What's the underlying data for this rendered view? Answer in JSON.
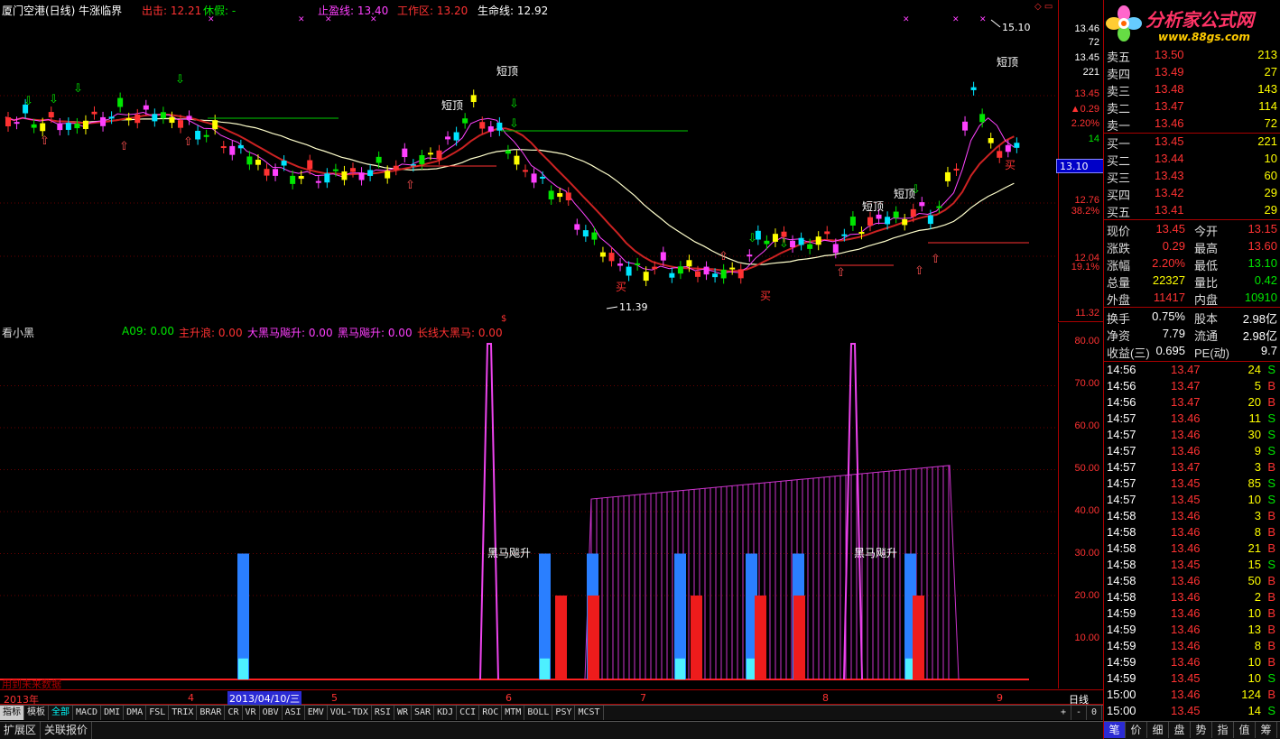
{
  "header": {
    "title": "厦门空港(日线) 牛涨临界",
    "items": [
      {
        "label": "出击:",
        "value": "12.21",
        "color": "#ff3232"
      },
      {
        "label": "休假:",
        "value": "-",
        "color": "#00e600"
      },
      {
        "label": "止盈线:",
        "value": "13.40",
        "color": "#ff40ff"
      },
      {
        "label": "工作区:",
        "value": "13.20",
        "color": "#ff3232"
      },
      {
        "label": "生命线:",
        "value": "12.92",
        "color": "#ffffff"
      }
    ]
  },
  "main_chart": {
    "high_label": "15.10",
    "low_label": "11.39",
    "annotations": [
      "短顶",
      "短顶",
      "短顶",
      "短顶",
      "短顶",
      "买",
      "买",
      "买"
    ],
    "price_marker": "13.10"
  },
  "price_axis": [
    {
      "v": "13.46",
      "c": "#fff"
    },
    {
      "v": "72",
      "c": "#fff"
    },
    {
      "v": "13.45",
      "c": "#fff"
    },
    {
      "v": "221",
      "c": "#fff"
    },
    {
      "v": "13.45",
      "c": "#ff3232"
    },
    {
      "v": "▲0.29",
      "c": "#ff3232"
    },
    {
      "v": "2.20%",
      "c": "#ff3232"
    },
    {
      "v": "14",
      "c": "#00e600"
    },
    {
      "v": "12.76",
      "c": "#ff3232"
    },
    {
      "v": "38.2%",
      "c": "#ff3232"
    },
    {
      "v": "12.04",
      "c": "#ff3232"
    },
    {
      "v": "19.1%",
      "c": "#ff3232"
    },
    {
      "v": "11.32",
      "c": "#ff3232"
    }
  ],
  "indicator": {
    "name": "看小黑",
    "items": [
      {
        "label": "A09:",
        "value": "0.00",
        "color": "#00e600"
      },
      {
        "label": "主升浪:",
        "value": "0.00",
        "color": "#ff3232"
      },
      {
        "label": "大黑马飚升:",
        "value": "0.00",
        "color": "#ff40ff"
      },
      {
        "label": "黑马飚升:",
        "value": "0.00",
        "color": "#ff40ff"
      },
      {
        "label": "长线大黑马:",
        "value": "0.00",
        "color": "#ff3232"
      }
    ],
    "labels": [
      "黑马飚升",
      "黑马飚升"
    ],
    "footnote": "用到未来数据",
    "axis": [
      "80.00",
      "70.00",
      "60.00",
      "50.00",
      "40.00",
      "30.00",
      "20.00",
      "10.00"
    ]
  },
  "timeline": {
    "year": "2013年",
    "months": [
      "4",
      "5",
      "6",
      "7",
      "8",
      "9"
    ],
    "cursor_date": "2013/04/10/三",
    "period": "日线"
  },
  "tabs": [
    "指标",
    "模板",
    "全部",
    "MACD",
    "DMI",
    "DMA",
    "FSL",
    "TRIX",
    "BRAR",
    "CR",
    "VR",
    "OBV",
    "ASI",
    "EMV",
    "VOL-TDX",
    "RSI",
    "WR",
    "SAR",
    "KDJ",
    "CCI",
    "ROC",
    "MTM",
    "BOLL",
    "PSY",
    "MCST"
  ],
  "tab_controls": [
    "+",
    "-",
    "0"
  ],
  "bottom_tabs": [
    "扩展区",
    "关联报价"
  ],
  "right_panel": {
    "logo": "分析家公式网",
    "logo_url": "www.88gs.com",
    "asks": [
      {
        "label": "卖五",
        "price": "13.50",
        "vol": "213"
      },
      {
        "label": "卖四",
        "price": "13.49",
        "vol": "27"
      },
      {
        "label": "卖三",
        "price": "13.48",
        "vol": "143"
      },
      {
        "label": "卖二",
        "price": "13.47",
        "vol": "114"
      },
      {
        "label": "卖一",
        "price": "13.46",
        "vol": "72"
      }
    ],
    "bids": [
      {
        "label": "买一",
        "price": "13.45",
        "vol": "221"
      },
      {
        "label": "买二",
        "price": "13.44",
        "vol": "10"
      },
      {
        "label": "买三",
        "price": "13.43",
        "vol": "60"
      },
      {
        "label": "买四",
        "price": "13.42",
        "vol": "29"
      },
      {
        "label": "买五",
        "price": "13.41",
        "vol": "29"
      }
    ],
    "quote": [
      {
        "l1": "现价",
        "v1": "13.45",
        "c1": "#ff3232",
        "l2": "今开",
        "v2": "13.15",
        "c2": "#ff3232"
      },
      {
        "l1": "涨跌",
        "v1": "0.29",
        "c1": "#ff3232",
        "l2": "最高",
        "v2": "13.60",
        "c2": "#ff3232"
      },
      {
        "l1": "涨幅",
        "v1": "2.20%",
        "c1": "#ff3232",
        "l2": "最低",
        "v2": "13.10",
        "c2": "#00e600"
      },
      {
        "l1": "总量",
        "v1": "22327",
        "c1": "#ffff00",
        "l2": "量比",
        "v2": "0.42",
        "c2": "#00e600"
      },
      {
        "l1": "外盘",
        "v1": "11417",
        "c1": "#ff3232",
        "l2": "内盘",
        "v2": "10910",
        "c2": "#00e600"
      }
    ],
    "stats": [
      {
        "l1": "换手",
        "v1": "0.75%",
        "l2": "股本",
        "v2": "2.98亿"
      },
      {
        "l1": "净资",
        "v1": "7.79",
        "l2": "流通",
        "v2": "2.98亿"
      },
      {
        "l1": "收益(三)",
        "v1": "0.695",
        "l2": "PE(动)",
        "v2": "9.7"
      }
    ],
    "ticks": [
      {
        "t": "14:56",
        "p": "13.47",
        "v": "24",
        "s": "S"
      },
      {
        "t": "14:56",
        "p": "13.47",
        "v": "5",
        "s": "B"
      },
      {
        "t": "14:56",
        "p": "13.47",
        "v": "20",
        "s": "B"
      },
      {
        "t": "14:57",
        "p": "13.46",
        "v": "11",
        "s": "S"
      },
      {
        "t": "14:57",
        "p": "13.46",
        "v": "30",
        "s": "S"
      },
      {
        "t": "14:57",
        "p": "13.46",
        "v": "9",
        "s": "S"
      },
      {
        "t": "14:57",
        "p": "13.47",
        "v": "3",
        "s": "B"
      },
      {
        "t": "14:57",
        "p": "13.45",
        "v": "85",
        "s": "S"
      },
      {
        "t": "14:57",
        "p": "13.45",
        "v": "10",
        "s": "S"
      },
      {
        "t": "14:58",
        "p": "13.46",
        "v": "3",
        "s": "B"
      },
      {
        "t": "14:58",
        "p": "13.46",
        "v": "8",
        "s": "B"
      },
      {
        "t": "14:58",
        "p": "13.46",
        "v": "21",
        "s": "B"
      },
      {
        "t": "14:58",
        "p": "13.45",
        "v": "15",
        "s": "S"
      },
      {
        "t": "14:58",
        "p": "13.46",
        "v": "50",
        "s": "B"
      },
      {
        "t": "14:58",
        "p": "13.46",
        "v": "2",
        "s": "B"
      },
      {
        "t": "14:59",
        "p": "13.46",
        "v": "10",
        "s": "B"
      },
      {
        "t": "14:59",
        "p": "13.46",
        "v": "13",
        "s": "B"
      },
      {
        "t": "14:59",
        "p": "13.46",
        "v": "8",
        "s": "B"
      },
      {
        "t": "14:59",
        "p": "13.46",
        "v": "10",
        "s": "B"
      },
      {
        "t": "14:59",
        "p": "13.45",
        "v": "10",
        "s": "S"
      },
      {
        "t": "15:00",
        "p": "13.46",
        "v": "124",
        "s": "B"
      },
      {
        "t": "15:00",
        "p": "13.45",
        "v": "14",
        "s": "S"
      }
    ],
    "bottom_tabs": [
      "笔",
      "价",
      "细",
      "盘",
      "势",
      "指",
      "值",
      "筹"
    ]
  }
}
